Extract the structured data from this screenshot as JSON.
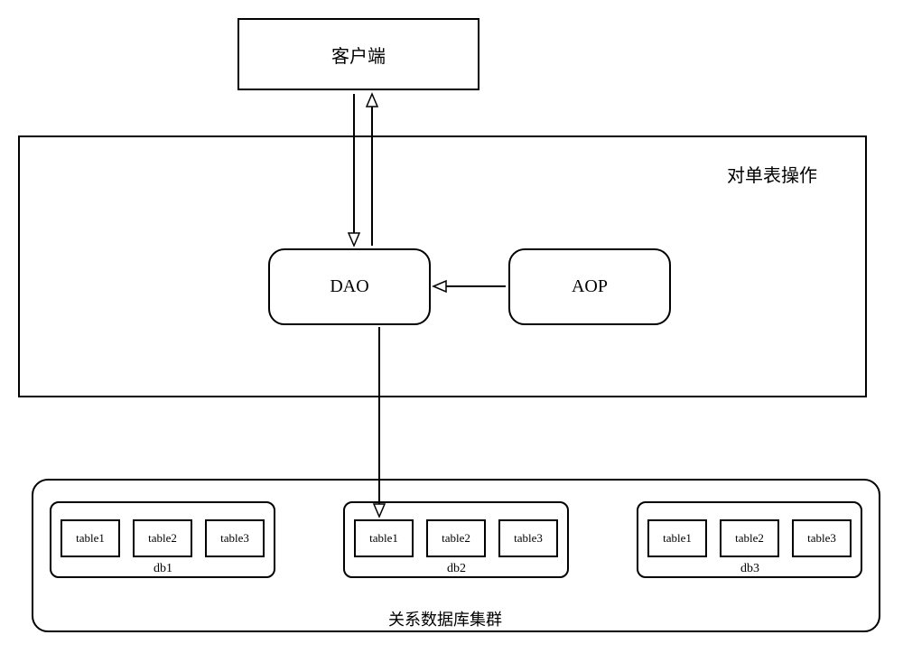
{
  "client": {
    "label": "客户端"
  },
  "singleTableOp": {
    "label": "对单表操作"
  },
  "dao": {
    "label": "DAO"
  },
  "aop": {
    "label": "AOP"
  },
  "cluster": {
    "label": "关系数据库集群"
  },
  "dbs": [
    {
      "name": "db1",
      "tables": [
        "table1",
        "table2",
        "table3"
      ]
    },
    {
      "name": "db2",
      "tables": [
        "table1",
        "table2",
        "table3"
      ]
    },
    {
      "name": "db3",
      "tables": [
        "table1",
        "table2",
        "table3"
      ]
    }
  ]
}
